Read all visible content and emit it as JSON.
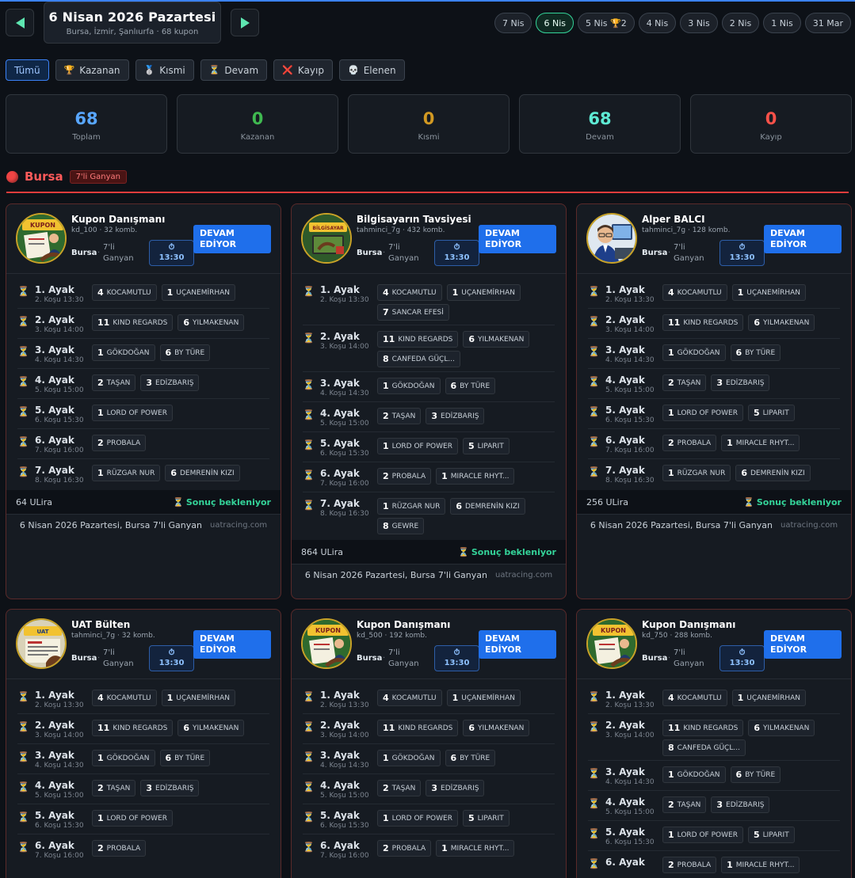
{
  "header": {
    "date_title": "6 Nisan 2026 Pazartesi",
    "date_subtitle": "Bursa, İzmir, Şanlıurfa · 68 kupon",
    "date_chips": [
      {
        "label": "7 Nis",
        "active": false
      },
      {
        "label": "6 Nis",
        "active": true
      },
      {
        "label": "5 Nis 🏆2",
        "active": false
      },
      {
        "label": "4 Nis",
        "active": false
      },
      {
        "label": "3 Nis",
        "active": false
      },
      {
        "label": "2 Nis",
        "active": false
      },
      {
        "label": "1 Nis",
        "active": false
      },
      {
        "label": "31 Mar",
        "active": false
      }
    ]
  },
  "filters": [
    {
      "label": "Tümü",
      "icon": "",
      "active": true
    },
    {
      "label": "Kazanan",
      "icon": "🏆",
      "active": false
    },
    {
      "label": "Kısmi",
      "icon": "🥈",
      "active": false
    },
    {
      "label": "Devam",
      "icon": "⏳",
      "active": false
    },
    {
      "label": "Kayıp",
      "icon": "❌",
      "active": false
    },
    {
      "label": "Elenen",
      "icon": "💀",
      "active": false
    }
  ],
  "stats": [
    {
      "value": "68",
      "label": "Toplam",
      "color": "#58a6ff"
    },
    {
      "value": "0",
      "label": "Kazanan",
      "color": "#3fb950"
    },
    {
      "value": "0",
      "label": "Kısmi",
      "color": "#d29922"
    },
    {
      "value": "68",
      "label": "Devam",
      "color": "#5eead4"
    },
    {
      "value": "0",
      "label": "Kayıp",
      "color": "#f85149"
    }
  ],
  "section": {
    "title": "Bursa",
    "badge": "7'li Ganyan"
  },
  "cards": [
    {
      "title": "Kupon Danışmanı",
      "subtitle": "kd_100 · 32 komb.",
      "city": "Bursa",
      "type": "7'li Ganyan",
      "time_icon": "⏱",
      "time": "13:30",
      "status": "DEVAM EDİYOR",
      "avatar": "kupon",
      "legs": [
        {
          "name": "1. Ayak",
          "race": "2. Koşu 13:30",
          "horses": [
            {
              "num": "4",
              "name": "KOCAMUTLU"
            },
            {
              "num": "1",
              "name": "UÇANEMİRHAN"
            }
          ]
        },
        {
          "name": "2. Ayak",
          "race": "3. Koşu 14:00",
          "horses": [
            {
              "num": "11",
              "name": "KIND REGARDS"
            },
            {
              "num": "6",
              "name": "YILMAKENAN"
            }
          ]
        },
        {
          "name": "3. Ayak",
          "race": "4. Koşu 14:30",
          "horses": [
            {
              "num": "1",
              "name": "GÖKDOĞAN"
            },
            {
              "num": "6",
              "name": "BY TÜRE"
            }
          ]
        },
        {
          "name": "4. Ayak",
          "race": "5. Koşu 15:00",
          "horses": [
            {
              "num": "2",
              "name": "TAŞAN"
            },
            {
              "num": "3",
              "name": "EDİZBARIŞ"
            }
          ]
        },
        {
          "name": "5. Ayak",
          "race": "6. Koşu 15:30",
          "horses": [
            {
              "num": "1",
              "name": "LORD OF POWER"
            }
          ]
        },
        {
          "name": "6. Ayak",
          "race": "7. Koşu 16:00",
          "horses": [
            {
              "num": "2",
              "name": "PROBALA"
            }
          ]
        },
        {
          "name": "7. Ayak",
          "race": "8. Koşu 16:30",
          "horses": [
            {
              "num": "1",
              "name": "RÜZGAR NUR"
            },
            {
              "num": "6",
              "name": "DEMRENİN KIZI"
            }
          ]
        }
      ],
      "stake": "64 ULira",
      "result": "Sonuç bekleniyor",
      "caption": "6 Nisan 2026 Pazartesi, Bursa 7'li Ganyan",
      "source": "uatracing.com"
    },
    {
      "title": "Bilgisayarın Tavsiyesi",
      "subtitle": "tahminci_7g · 432 komb.",
      "city": "Bursa",
      "type": "7'li Ganyan",
      "time_icon": "⏱",
      "time": "13:30",
      "status": "DEVAM EDİYOR",
      "avatar": "bilgisayar",
      "legs": [
        {
          "name": "1. Ayak",
          "race": "2. Koşu 13:30",
          "horses": [
            {
              "num": "4",
              "name": "KOCAMUTLU"
            },
            {
              "num": "1",
              "name": "UÇANEMİRHAN"
            },
            {
              "num": "7",
              "name": "SANCAR EFESİ"
            }
          ]
        },
        {
          "name": "2. Ayak",
          "race": "3. Koşu 14:00",
          "horses": [
            {
              "num": "11",
              "name": "KIND REGARDS"
            },
            {
              "num": "6",
              "name": "YILMAKENAN"
            },
            {
              "num": "8",
              "name": "CANFEDA GÜÇL..."
            }
          ]
        },
        {
          "name": "3. Ayak",
          "race": "4. Koşu 14:30",
          "horses": [
            {
              "num": "1",
              "name": "GÖKDOĞAN"
            },
            {
              "num": "6",
              "name": "BY TÜRE"
            }
          ]
        },
        {
          "name": "4. Ayak",
          "race": "5. Koşu 15:00",
          "horses": [
            {
              "num": "2",
              "name": "TAŞAN"
            },
            {
              "num": "3",
              "name": "EDİZBARIŞ"
            }
          ]
        },
        {
          "name": "5. Ayak",
          "race": "6. Koşu 15:30",
          "horses": [
            {
              "num": "1",
              "name": "LORD OF POWER"
            },
            {
              "num": "5",
              "name": "LIPARIT"
            }
          ]
        },
        {
          "name": "6. Ayak",
          "race": "7. Koşu 16:00",
          "horses": [
            {
              "num": "2",
              "name": "PROBALA"
            },
            {
              "num": "1",
              "name": "MIRACLE RHYT..."
            }
          ]
        },
        {
          "name": "7. Ayak",
          "race": "8. Koşu 16:30",
          "horses": [
            {
              "num": "1",
              "name": "RÜZGAR NUR"
            },
            {
              "num": "6",
              "name": "DEMRENİN KIZI"
            },
            {
              "num": "8",
              "name": "GEWRE"
            }
          ]
        }
      ],
      "stake": "864 ULira",
      "result": "Sonuç bekleniyor",
      "caption": "6 Nisan 2026 Pazartesi, Bursa 7'li Ganyan",
      "source": "uatracing.com"
    },
    {
      "title": "Alper BALCI",
      "subtitle": "tahminci_7g · 128 komb.",
      "city": "Bursa",
      "type": "7'li Ganyan",
      "time_icon": "⏱",
      "time": "13:30",
      "status": "DEVAM EDİYOR",
      "avatar": "alper",
      "legs": [
        {
          "name": "1. Ayak",
          "race": "2. Koşu 13:30",
          "horses": [
            {
              "num": "4",
              "name": "KOCAMUTLU"
            },
            {
              "num": "1",
              "name": "UÇANEMİRHAN"
            }
          ]
        },
        {
          "name": "2. Ayak",
          "race": "3. Koşu 14:00",
          "horses": [
            {
              "num": "11",
              "name": "KIND REGARDS"
            },
            {
              "num": "6",
              "name": "YILMAKENAN"
            }
          ]
        },
        {
          "name": "3. Ayak",
          "race": "4. Koşu 14:30",
          "horses": [
            {
              "num": "1",
              "name": "GÖKDOĞAN"
            },
            {
              "num": "6",
              "name": "BY TÜRE"
            }
          ]
        },
        {
          "name": "4. Ayak",
          "race": "5. Koşu 15:00",
          "horses": [
            {
              "num": "2",
              "name": "TAŞAN"
            },
            {
              "num": "3",
              "name": "EDİZBARIŞ"
            }
          ]
        },
        {
          "name": "5. Ayak",
          "race": "6. Koşu 15:30",
          "horses": [
            {
              "num": "1",
              "name": "LORD OF POWER"
            },
            {
              "num": "5",
              "name": "LIPARIT"
            }
          ]
        },
        {
          "name": "6. Ayak",
          "race": "7. Koşu 16:00",
          "horses": [
            {
              "num": "2",
              "name": "PROBALA"
            },
            {
              "num": "1",
              "name": "MIRACLE RHYT..."
            }
          ]
        },
        {
          "name": "7. Ayak",
          "race": "8. Koşu 16:30",
          "horses": [
            {
              "num": "1",
              "name": "RÜZGAR NUR"
            },
            {
              "num": "6",
              "name": "DEMRENİN KIZI"
            }
          ]
        }
      ],
      "stake": "256 ULira",
      "result": "Sonuç bekleniyor",
      "caption": "6 Nisan 2026 Pazartesi, Bursa 7'li Ganyan",
      "source": "uatracing.com"
    },
    {
      "title": "UAT Bülten",
      "subtitle": "tahminci_7g · 32 komb.",
      "city": "Bursa",
      "type": "7'li Ganyan",
      "time_icon": "⏱",
      "time": "13:30",
      "status": "DEVAM EDİYOR",
      "avatar": "uat",
      "legs": [
        {
          "name": "1. Ayak",
          "race": "2. Koşu 13:30",
          "horses": [
            {
              "num": "4",
              "name": "KOCAMUTLU"
            },
            {
              "num": "1",
              "name": "UÇANEMİRHAN"
            }
          ]
        },
        {
          "name": "2. Ayak",
          "race": "3. Koşu 14:00",
          "horses": [
            {
              "num": "11",
              "name": "KIND REGARDS"
            },
            {
              "num": "6",
              "name": "YILMAKENAN"
            }
          ]
        },
        {
          "name": "3. Ayak",
          "race": "4. Koşu 14:30",
          "horses": [
            {
              "num": "1",
              "name": "GÖKDOĞAN"
            },
            {
              "num": "6",
              "name": "BY TÜRE"
            }
          ]
        },
        {
          "name": "4. Ayak",
          "race": "5. Koşu 15:00",
          "horses": [
            {
              "num": "2",
              "name": "TAŞAN"
            },
            {
              "num": "3",
              "name": "EDİZBARIŞ"
            }
          ]
        },
        {
          "name": "5. Ayak",
          "race": "6. Koşu 15:30",
          "horses": [
            {
              "num": "1",
              "name": "LORD OF POWER"
            }
          ]
        },
        {
          "name": "6. Ayak",
          "race": "7. Koşu 16:00",
          "horses": [
            {
              "num": "2",
              "name": "PROBALA"
            }
          ]
        }
      ],
      "stake": "",
      "result": "",
      "caption": "",
      "source": ""
    },
    {
      "title": "Kupon Danışmanı",
      "subtitle": "kd_500 · 192 komb.",
      "city": "Bursa",
      "type": "7'li Ganyan",
      "time_icon": "⏱",
      "time": "13:30",
      "status": "DEVAM EDİYOR",
      "avatar": "kupon",
      "legs": [
        {
          "name": "1. Ayak",
          "race": "2. Koşu 13:30",
          "horses": [
            {
              "num": "4",
              "name": "KOCAMUTLU"
            },
            {
              "num": "1",
              "name": "UÇANEMİRHAN"
            }
          ]
        },
        {
          "name": "2. Ayak",
          "race": "3. Koşu 14:00",
          "horses": [
            {
              "num": "11",
              "name": "KIND REGARDS"
            },
            {
              "num": "6",
              "name": "YILMAKENAN"
            }
          ]
        },
        {
          "name": "3. Ayak",
          "race": "4. Koşu 14:30",
          "horses": [
            {
              "num": "1",
              "name": "GÖKDOĞAN"
            },
            {
              "num": "6",
              "name": "BY TÜRE"
            }
          ]
        },
        {
          "name": "4. Ayak",
          "race": "5. Koşu 15:00",
          "horses": [
            {
              "num": "2",
              "name": "TAŞAN"
            },
            {
              "num": "3",
              "name": "EDİZBARIŞ"
            }
          ]
        },
        {
          "name": "5. Ayak",
          "race": "6. Koşu 15:30",
          "horses": [
            {
              "num": "1",
              "name": "LORD OF POWER"
            },
            {
              "num": "5",
              "name": "LIPARIT"
            }
          ]
        },
        {
          "name": "6. Ayak",
          "race": "7. Koşu 16:00",
          "horses": [
            {
              "num": "2",
              "name": "PROBALA"
            },
            {
              "num": "1",
              "name": "MIRACLE RHYT..."
            }
          ]
        }
      ],
      "stake": "",
      "result": "",
      "caption": "",
      "source": ""
    },
    {
      "title": "Kupon Danışmanı",
      "subtitle": "kd_750 · 288 komb.",
      "city": "Bursa",
      "type": "7'li Ganyan",
      "time_icon": "⏱",
      "time": "13:30",
      "status": "DEVAM EDİYOR",
      "avatar": "kupon",
      "legs": [
        {
          "name": "1. Ayak",
          "race": "2. Koşu 13:30",
          "horses": [
            {
              "num": "4",
              "name": "KOCAMUTLU"
            },
            {
              "num": "1",
              "name": "UÇANEMİRHAN"
            }
          ]
        },
        {
          "name": "2. Ayak",
          "race": "3. Koşu 14:00",
          "horses": [
            {
              "num": "11",
              "name": "KIND REGARDS"
            },
            {
              "num": "6",
              "name": "YILMAKENAN"
            },
            {
              "num": "8",
              "name": "CANFEDA GÜÇL..."
            }
          ]
        },
        {
          "name": "3. Ayak",
          "race": "4. Koşu 14:30",
          "horses": [
            {
              "num": "1",
              "name": "GÖKDOĞAN"
            },
            {
              "num": "6",
              "name": "BY TÜRE"
            }
          ]
        },
        {
          "name": "4. Ayak",
          "race": "5. Koşu 15:00",
          "horses": [
            {
              "num": "2",
              "name": "TAŞAN"
            },
            {
              "num": "3",
              "name": "EDİZBARIŞ"
            }
          ]
        },
        {
          "name": "5. Ayak",
          "race": "6. Koşu 15:30",
          "horses": [
            {
              "num": "1",
              "name": "LORD OF POWER"
            },
            {
              "num": "5",
              "name": "LIPARIT"
            }
          ]
        },
        {
          "name": "6. Ayak",
          "race": "",
          "horses": [
            {
              "num": "2",
              "name": "PROBALA"
            },
            {
              "num": "1",
              "name": "MIRACLE RHYT..."
            }
          ]
        }
      ],
      "stake": "",
      "result": "",
      "caption": "",
      "source": ""
    }
  ]
}
